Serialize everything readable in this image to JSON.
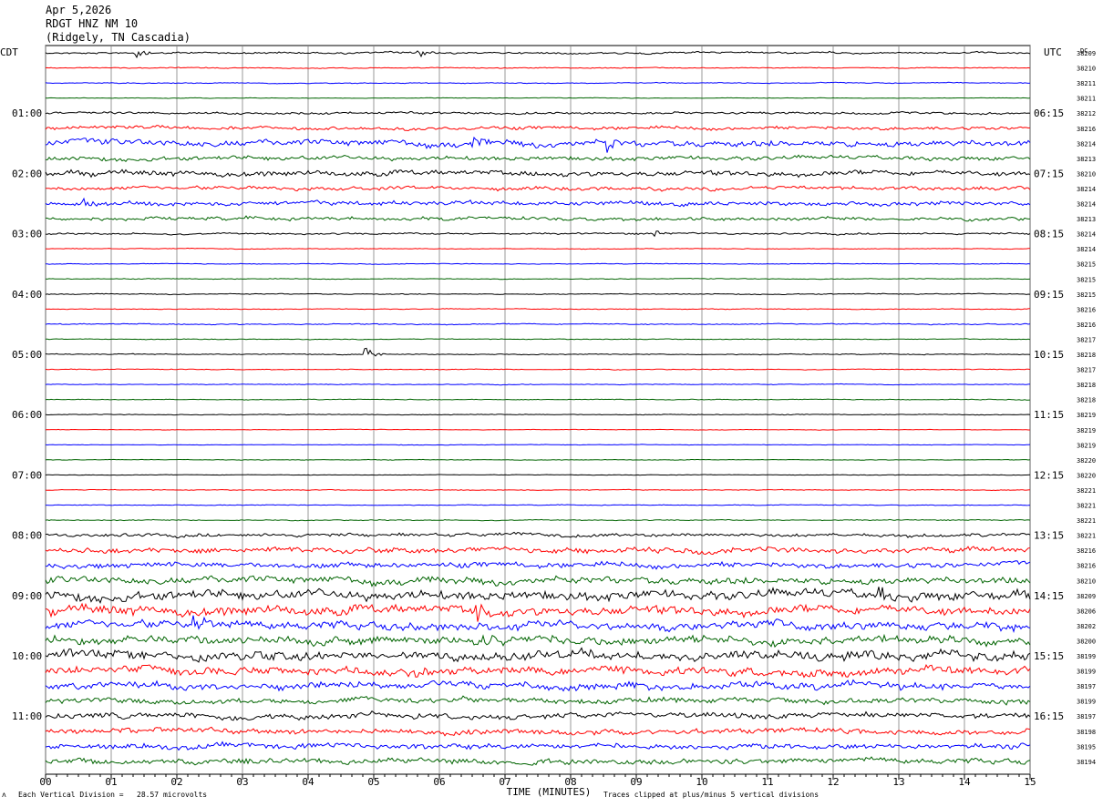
{
  "header": {
    "date": "Apr 5,2026",
    "station": "RDGT HNZ NM 10",
    "location": "(Ridgely, TN Cascadia)"
  },
  "axes": {
    "left_zone": "CDT",
    "right_zone": "UTC",
    "dc_label": "DC",
    "xlabel": "TIME (MINUTES)"
  },
  "footer": {
    "division_note": "Each Vertical Division =   28.57 microvolts",
    "clip_note": "Traces clipped at plus/minus 5 vertical divisions",
    "corner_mark": "ʌ"
  },
  "colors": {
    "trace_cycle": [
      "#000000",
      "#ff0000",
      "#0000ff",
      "#006400"
    ],
    "grid": "#808080"
  },
  "chart_data": {
    "type": "line",
    "title": "RDGT HNZ NM 10",
    "xlabel": "TIME (MINUTES)",
    "xlim": [
      0,
      15
    ],
    "x_ticks": [
      "00",
      "01",
      "02",
      "03",
      "04",
      "05",
      "06",
      "07",
      "08",
      "09",
      "10",
      "11",
      "12",
      "13",
      "14",
      "15"
    ],
    "left_time_labels": [
      "01:00",
      "02:00",
      "03:00",
      "04:00",
      "05:00",
      "06:00",
      "07:00",
      "08:00",
      "09:00",
      "10:00",
      "11:00"
    ],
    "right_time_labels": [
      "06:15",
      "07:15",
      "08:15",
      "09:15",
      "10:15",
      "11:15",
      "12:15",
      "13:15",
      "14:15",
      "15:15",
      "16:15"
    ],
    "dc_offsets": [
      "38209",
      "38210",
      "38211",
      "38211",
      "38212",
      "38216",
      "38214",
      "38213",
      "38210",
      "38214",
      "38214",
      "38213",
      "38214",
      "38214",
      "38215",
      "38215",
      "38215",
      "38216",
      "38216",
      "38217",
      "38218",
      "38217",
      "38218",
      "38218",
      "38219",
      "38219",
      "38219",
      "38220",
      "38220",
      "38221",
      "38221",
      "38221",
      "38221",
      "38216",
      "38216",
      "38210",
      "38209",
      "38206",
      "38202",
      "38200",
      "38199",
      "38199",
      "38197",
      "38199",
      "38197",
      "38198",
      "38195",
      "38194"
    ],
    "trace_activity": [
      1.0,
      0.5,
      0.5,
      0.3,
      1.2,
      1.8,
      3.5,
      2.2,
      2.8,
      2.0,
      2.4,
      1.8,
      0.9,
      0.4,
      0.4,
      0.4,
      0.5,
      0.4,
      0.6,
      0.4,
      0.5,
      0.4,
      0.4,
      0.4,
      0.4,
      0.3,
      0.3,
      0.3,
      0.3,
      0.4,
      0.4,
      0.5,
      1.8,
      3.0,
      3.0,
      4.0,
      5.0,
      5.0,
      4.5,
      4.5,
      5.0,
      4.5,
      4.0,
      3.0,
      3.0,
      3.0,
      3.0,
      3.0
    ],
    "events": [
      {
        "trace": 0,
        "minute": 1.4,
        "amp": 6
      },
      {
        "trace": 0,
        "minute": 5.7,
        "amp": 5
      },
      {
        "trace": 6,
        "minute": 6.5,
        "amp": 9
      },
      {
        "trace": 6,
        "minute": 8.6,
        "amp": 10
      },
      {
        "trace": 10,
        "minute": 0.6,
        "amp": 7
      },
      {
        "trace": 12,
        "minute": 9.3,
        "amp": 5
      },
      {
        "trace": 20,
        "minute": 4.9,
        "amp": 8
      },
      {
        "trace": 36,
        "minute": 12.7,
        "amp": 9
      },
      {
        "trace": 37,
        "minute": 6.6,
        "amp": 10
      },
      {
        "trace": 38,
        "minute": 2.3,
        "amp": 10
      },
      {
        "trace": 39,
        "minute": 6.7,
        "amp": 10
      },
      {
        "trace": 41,
        "minute": 8.8,
        "amp": 9
      }
    ]
  }
}
